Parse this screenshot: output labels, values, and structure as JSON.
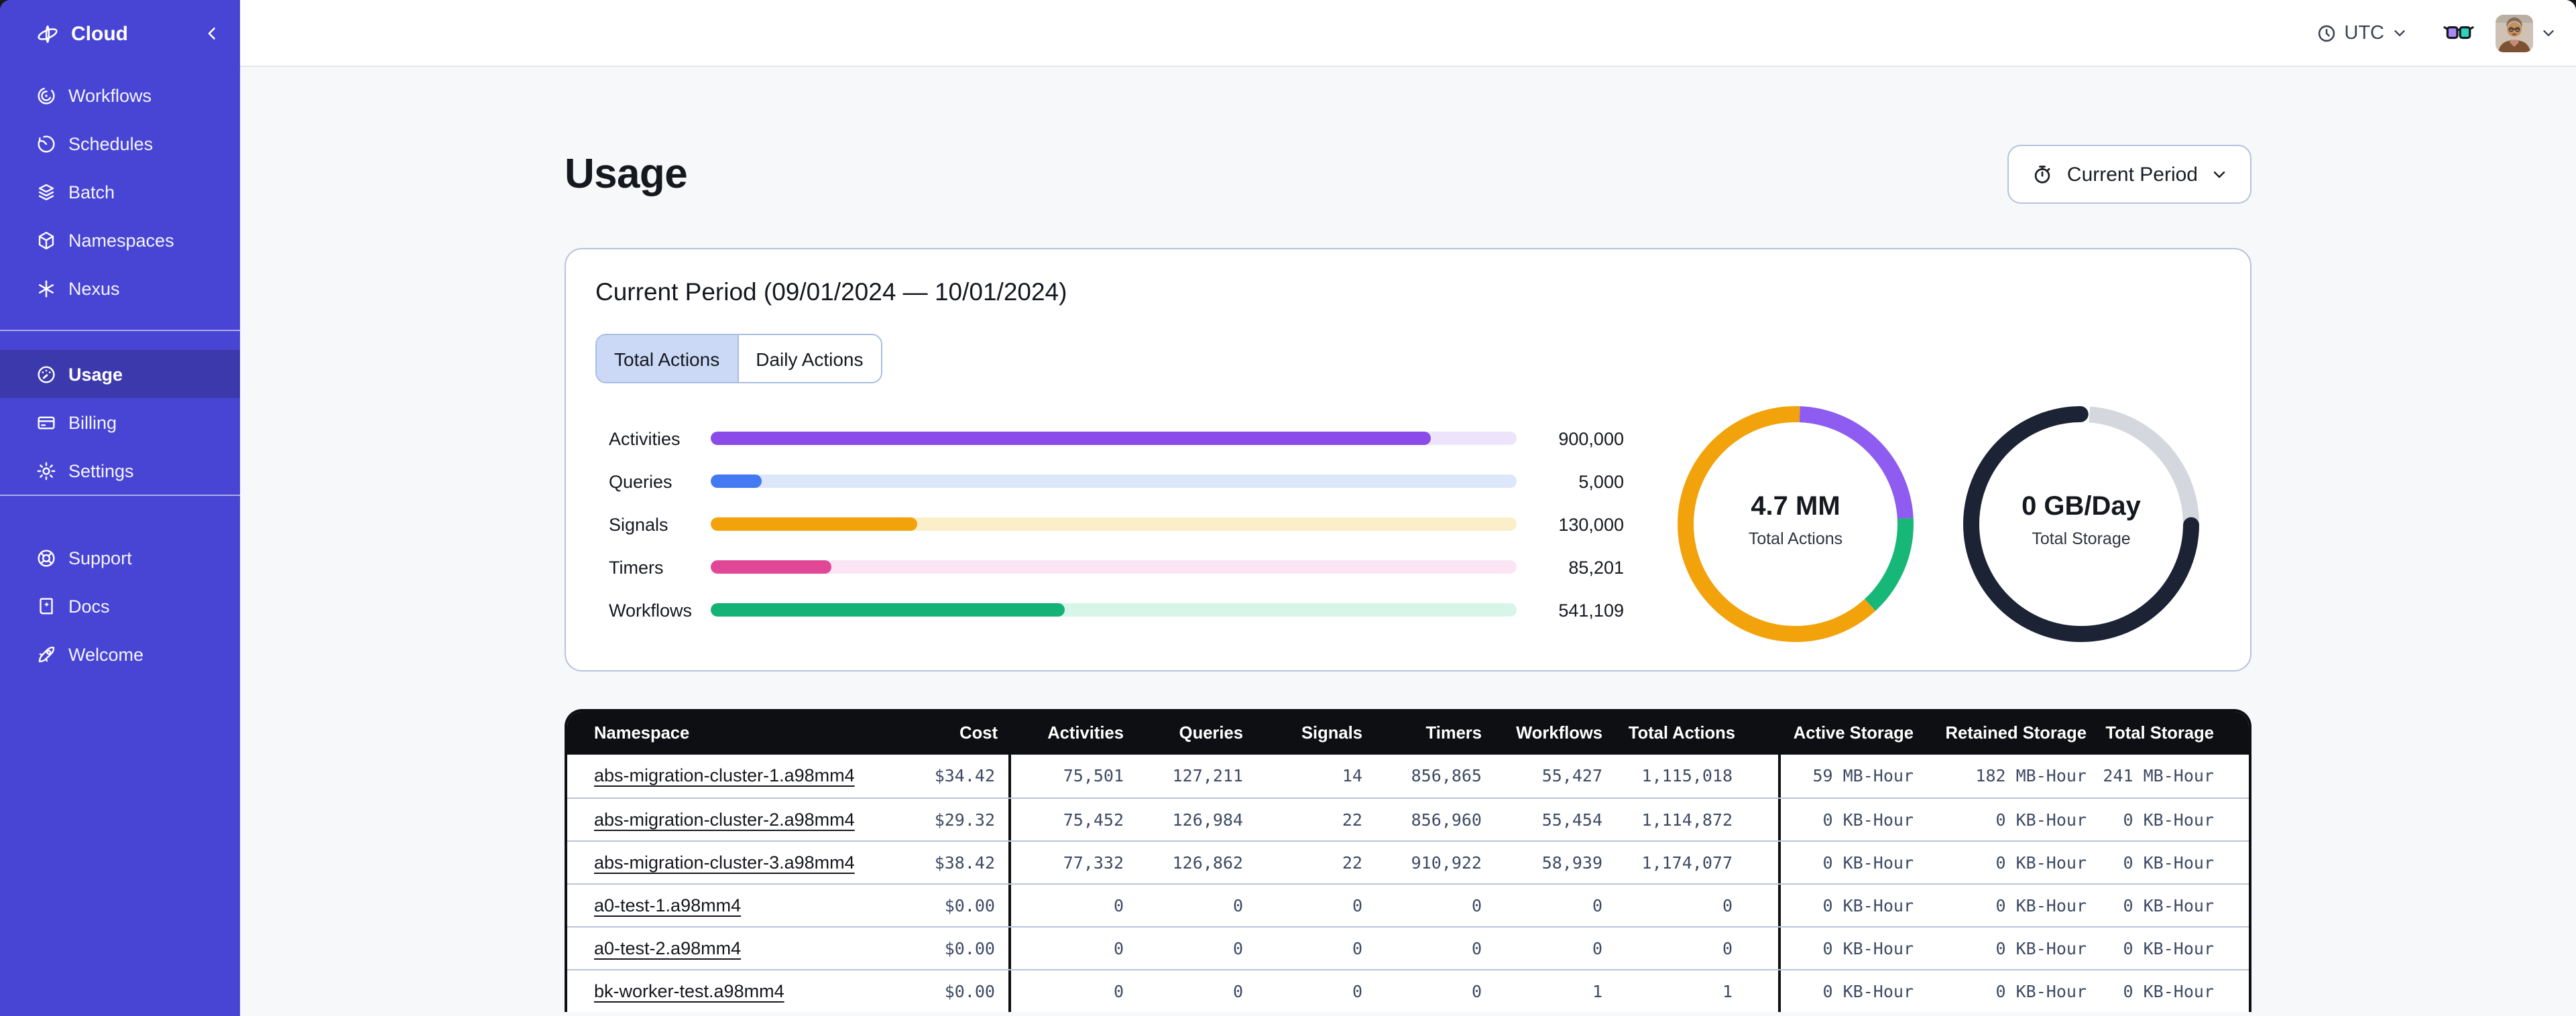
{
  "topbar": {
    "timezone": "UTC"
  },
  "sidebar": {
    "brand": "Cloud",
    "groups": [
      {
        "items": [
          {
            "label": "Workflows",
            "icon": "workflows-icon"
          },
          {
            "label": "Schedules",
            "icon": "schedules-icon"
          },
          {
            "label": "Batch",
            "icon": "batch-icon"
          },
          {
            "label": "Namespaces",
            "icon": "namespaces-icon"
          },
          {
            "label": "Nexus",
            "icon": "nexus-icon"
          }
        ]
      },
      {
        "items": [
          {
            "label": "Usage",
            "icon": "gauge-icon",
            "active": true
          },
          {
            "label": "Billing",
            "icon": "billing-icon"
          },
          {
            "label": "Settings",
            "icon": "gear-icon"
          }
        ]
      },
      {
        "items": [
          {
            "label": "Support",
            "icon": "lifebuoy-icon"
          },
          {
            "label": "Docs",
            "icon": "book-icon"
          },
          {
            "label": "Welcome",
            "icon": "rocket-icon"
          }
        ]
      }
    ]
  },
  "page": {
    "title": "Usage",
    "period_button": "Current Period"
  },
  "card": {
    "title": "Current Period (09/01/2024 — 10/01/2024)",
    "tabs": [
      "Total Actions",
      "Daily Actions"
    ]
  },
  "chart_data": [
    {
      "type": "bar",
      "title": "Usage by action type",
      "categories": [
        "Activities",
        "Queries",
        "Signals",
        "Timers",
        "Workflows"
      ],
      "values": [
        900000,
        5000,
        130000,
        85201,
        541109
      ],
      "value_labels": [
        "900,000",
        "5,000",
        "130,000",
        "85,201",
        "541,109"
      ],
      "fill_ratios": [
        0.894,
        0.063,
        0.256,
        0.15,
        0.44
      ],
      "colors": [
        "#8A4BE8",
        "#4379F2",
        "#F2A30C",
        "#E04797",
        "#14B277"
      ],
      "track_colors": [
        "#EDE4FB",
        "#DCE7FB",
        "#FBEFC9",
        "#FBE5F4",
        "#D8F5E9"
      ]
    },
    {
      "type": "pie",
      "center_value": "4.7 MM",
      "center_label": "Total Actions",
      "segments": [
        {
          "name": "purple",
          "color": "#8E5CF0",
          "start": 0.006,
          "sweep": 0.236
        },
        {
          "name": "green",
          "color": "#17B877",
          "start": 0.242,
          "sweep": 0.14
        },
        {
          "name": "orange",
          "color": "#F2A30C",
          "start": 0.382,
          "sweep": 0.624
        }
      ]
    },
    {
      "type": "pie",
      "center_value": "0 GB/Day",
      "center_label": "Total Storage",
      "segments": [
        {
          "name": "track",
          "color": "#D4D7DD",
          "start": 0.012,
          "sweep": 0.24
        },
        {
          "name": "dark",
          "color": "#1B2334",
          "start": 0.252,
          "sweep": 0.748,
          "rounded": true
        }
      ]
    }
  ],
  "table": {
    "columns": [
      "Namespace",
      "Cost",
      "Activities",
      "Queries",
      "Signals",
      "Timers",
      "Workflows",
      "Total Actions",
      "Active Storage",
      "Retained Storage",
      "Total Storage"
    ],
    "rows": [
      [
        "abs-migration-cluster-1.a98mm4",
        "$34.42",
        "75,501",
        "127,211",
        "14",
        "856,865",
        "55,427",
        "1,115,018",
        "59 MB-Hour",
        "182 MB-Hour",
        "241 MB-Hour"
      ],
      [
        "abs-migration-cluster-2.a98mm4",
        "$29.32",
        "75,452",
        "126,984",
        "22",
        "856,960",
        "55,454",
        "1,114,872",
        "0 KB-Hour",
        "0 KB-Hour",
        "0 KB-Hour"
      ],
      [
        "abs-migration-cluster-3.a98mm4",
        "$38.42",
        "77,332",
        "126,862",
        "22",
        "910,922",
        "58,939",
        "1,174,077",
        "0 KB-Hour",
        "0 KB-Hour",
        "0 KB-Hour"
      ],
      [
        "a0-test-1.a98mm4",
        "$0.00",
        "0",
        "0",
        "0",
        "0",
        "0",
        "0",
        "0 KB-Hour",
        "0 KB-Hour",
        "0 KB-Hour"
      ],
      [
        "a0-test-2.a98mm4",
        "$0.00",
        "0",
        "0",
        "0",
        "0",
        "0",
        "0",
        "0 KB-Hour",
        "0 KB-Hour",
        "0 KB-Hour"
      ],
      [
        "bk-worker-test.a98mm4",
        "$0.00",
        "0",
        "0",
        "0",
        "0",
        "1",
        "1",
        "0 KB-Hour",
        "0 KB-Hour",
        "0 KB-Hour"
      ]
    ]
  },
  "colors": {
    "sidebar": "#4845D4",
    "sidebar_active": "#3C39AC",
    "card_border": "#B5C2DE",
    "tab_selected": "#CBD9F6",
    "table_header": "#0D0F12",
    "row_divider": "#B9C5DC"
  }
}
